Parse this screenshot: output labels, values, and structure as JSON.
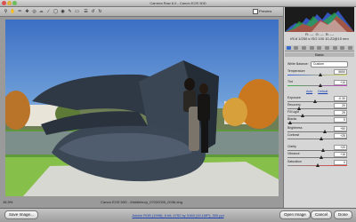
{
  "window": {
    "title": "Camera Raw 6.0 - Canon EOS 50D"
  },
  "toolbar": {
    "tools": [
      "zoom-icon",
      "hand-icon",
      "white-balance-icon",
      "color-sampler-icon",
      "target-adjust-icon",
      "crop-icon",
      "straighten-icon",
      "spot-removal-icon",
      "red-eye-icon",
      "brush-icon",
      "gradient-icon",
      "preferences-icon",
      "rotate-left-icon",
      "rotate-right-icon"
    ],
    "preview_label": "Preview"
  },
  "status": {
    "zoom": "15.3%",
    "caption": "Canon EOS 50D  -  Middlebury_07032009_0036.dng"
  },
  "panel": {
    "rgb": {
      "r": "R: ---",
      "g": "G: ---",
      "b": "B: ---"
    },
    "exif": "f/5.6  1/250 s  ISO 100  10-22@10 mm",
    "section": "Basic",
    "white_balance": {
      "label": "White Balance:",
      "value": "Custom"
    },
    "auto_label": "Auto",
    "default_label": "Default",
    "sliders": [
      {
        "label": "Temperature",
        "value": "5650",
        "type": "temp",
        "pos": 0.55
      },
      {
        "label": "Tint",
        "value": "+10",
        "type": "tint",
        "pos": 0.55
      },
      {
        "label": "Exposure",
        "value": "-0.30",
        "type": "plain",
        "pos": 0.47
      },
      {
        "label": "Recovery",
        "value": "20",
        "type": "plain",
        "pos": 0.2
      },
      {
        "label": "Fill Light",
        "value": "25",
        "type": "plain",
        "pos": 0.25
      },
      {
        "label": "Blacks",
        "value": "5",
        "type": "plain",
        "pos": 0.05
      },
      {
        "label": "Brightness",
        "value": "+50",
        "type": "plain",
        "pos": 0.62
      },
      {
        "label": "Contrast",
        "value": "+25",
        "type": "plain",
        "pos": 0.56
      },
      {
        "label": "Clarity",
        "value": "+20",
        "type": "plain",
        "pos": 0.6
      },
      {
        "label": "Vibrance",
        "value": "+15",
        "type": "plain",
        "pos": 0.57
      },
      {
        "label": "Saturation",
        "value": "0",
        "type": "sat",
        "pos": 0.5
      }
    ]
  },
  "bottom": {
    "save_label": "Save Image...",
    "workflow_link": "Adobe RGB (1998); 8 bit; 4752 by 3168 (15.1MP); 300 ppi",
    "open_label": "Open Image",
    "cancel_label": "Cancel",
    "done_label": "Done"
  }
}
